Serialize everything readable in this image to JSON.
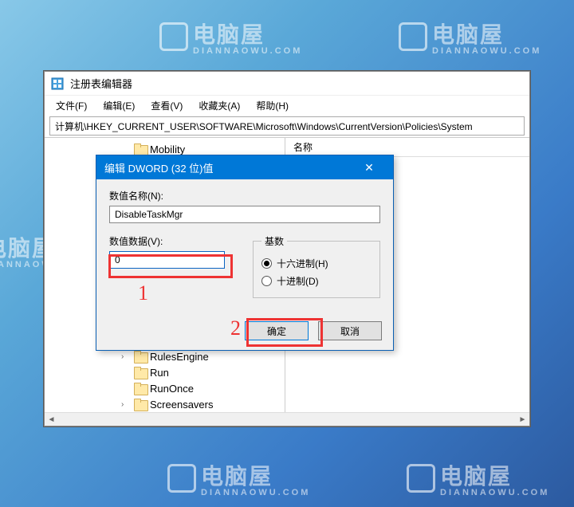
{
  "window": {
    "title": "注册表编辑器",
    "menus": {
      "file": "文件(F)",
      "edit": "编辑(E)",
      "view": "查看(V)",
      "favorites": "收藏夹(A)",
      "help": "帮助(H)"
    },
    "address": "计算机\\HKEY_CURRENT_USER\\SOFTWARE\\Microsoft\\Windows\\CurrentVersion\\Policies\\System",
    "list_header_name": "名称"
  },
  "tree": {
    "items_top": [
      {
        "label": "Mobility",
        "expandable": false
      }
    ],
    "items_bottom": [
      {
        "label": "RulesEngine",
        "expandable": true
      },
      {
        "label": "Run",
        "expandable": false
      },
      {
        "label": "RunOnce",
        "expandable": false
      },
      {
        "label": "Screensavers",
        "expandable": true
      }
    ]
  },
  "dialog": {
    "title": "编辑 DWORD (32 位)值",
    "name_label": "数值名称(N):",
    "name_value": "DisableTaskMgr",
    "value_label": "数值数据(V):",
    "value_data": "0",
    "base_label": "基数",
    "radio_hex": "十六进制(H)",
    "radio_dec": "十进制(D)",
    "ok": "确定",
    "cancel": "取消"
  },
  "annotations": {
    "one": "1",
    "two": "2"
  },
  "watermark": {
    "text": "电脑屋",
    "sub": "DIANNAOWU.COM"
  }
}
